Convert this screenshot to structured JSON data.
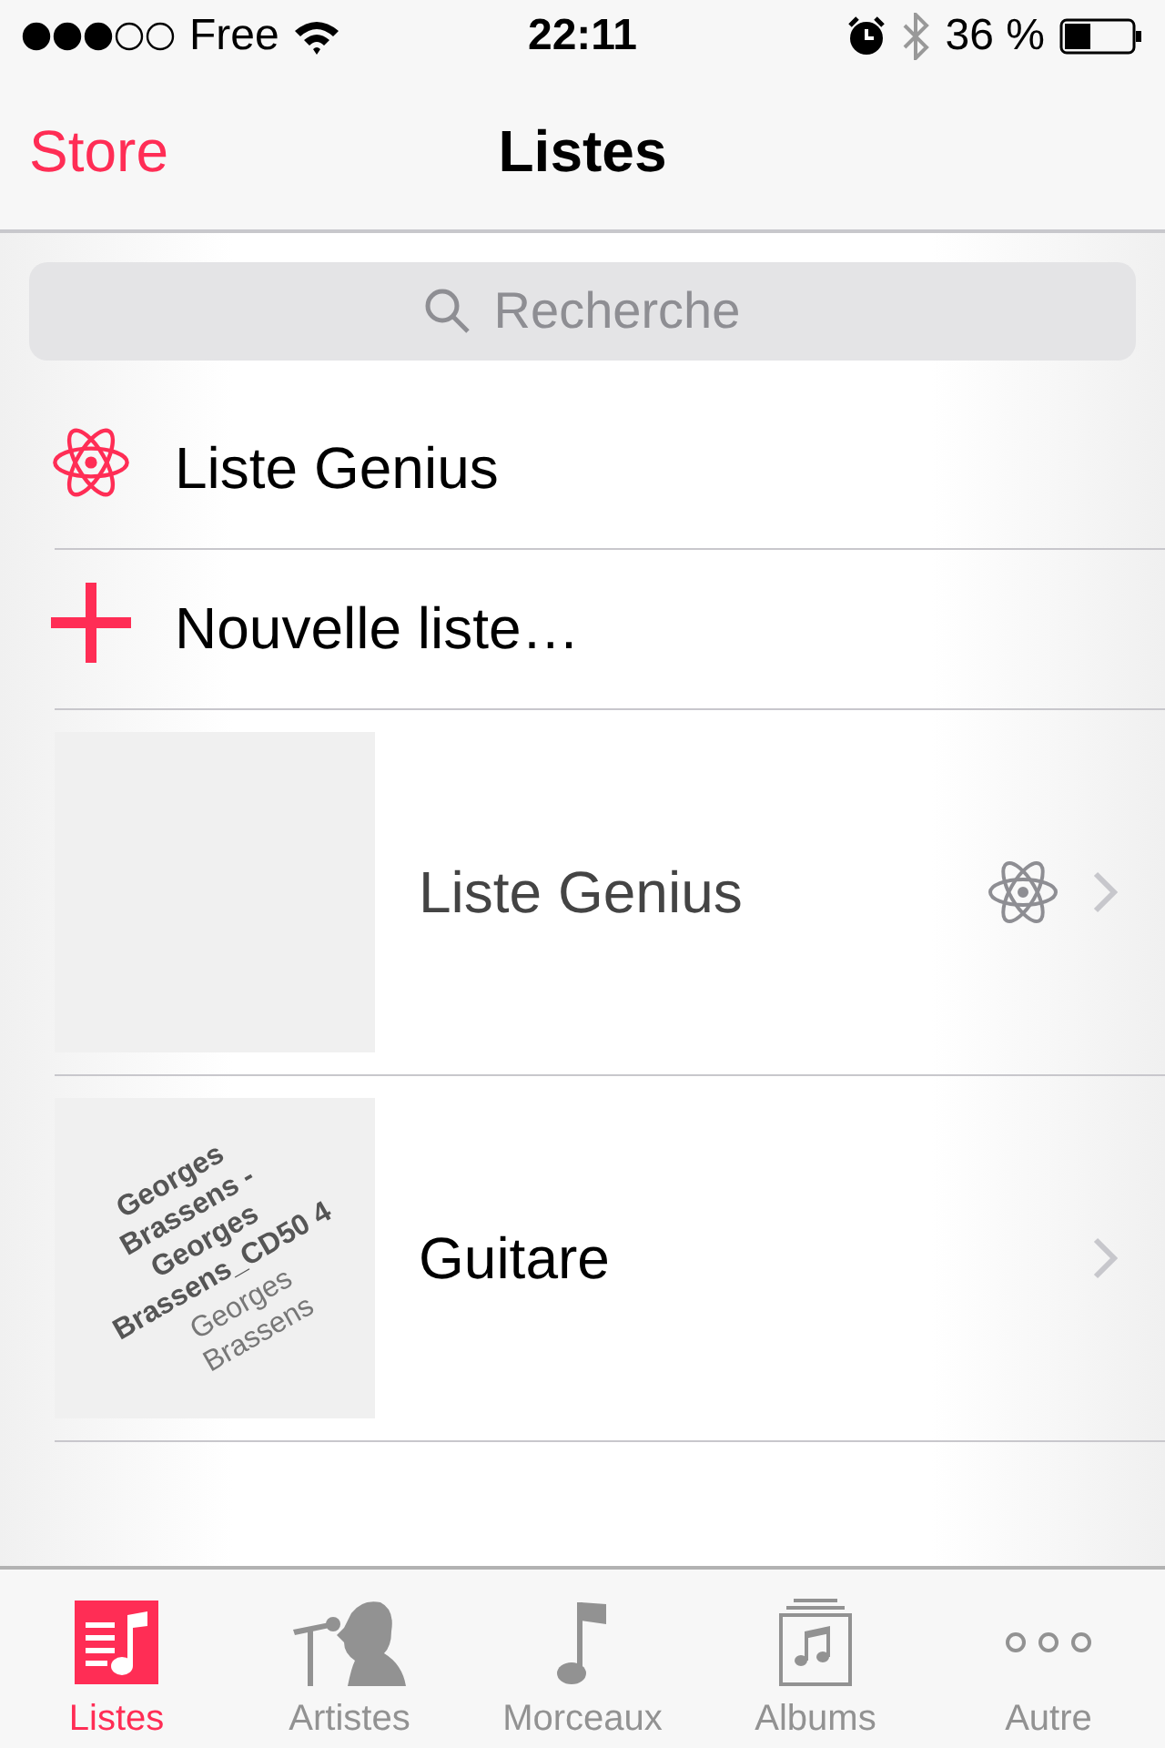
{
  "status_bar": {
    "carrier": "Free",
    "time": "22:11",
    "battery": "36 %"
  },
  "nav": {
    "back": "Store",
    "title": "Listes"
  },
  "search": {
    "placeholder": "Recherche"
  },
  "actions": [
    {
      "kind": "genius",
      "label": "Liste Genius"
    },
    {
      "kind": "new",
      "label": "Nouvelle liste…"
    }
  ],
  "playlists": [
    {
      "name": "Liste Genius",
      "kind": "genius"
    },
    {
      "name": "Guitare",
      "kind": "normal",
      "art": {
        "title": "Georges Brassens - Georges Brassens_CD50 4",
        "artist": "Georges Brassens"
      }
    }
  ],
  "tabs": [
    {
      "label": "Listes",
      "kind": "playlist",
      "selected": true
    },
    {
      "label": "Artistes",
      "kind": "artist",
      "selected": false
    },
    {
      "label": "Morceaux",
      "kind": "note",
      "selected": false
    },
    {
      "label": "Albums",
      "kind": "album",
      "selected": false
    },
    {
      "label": "Autre",
      "kind": "more",
      "selected": false
    }
  ]
}
